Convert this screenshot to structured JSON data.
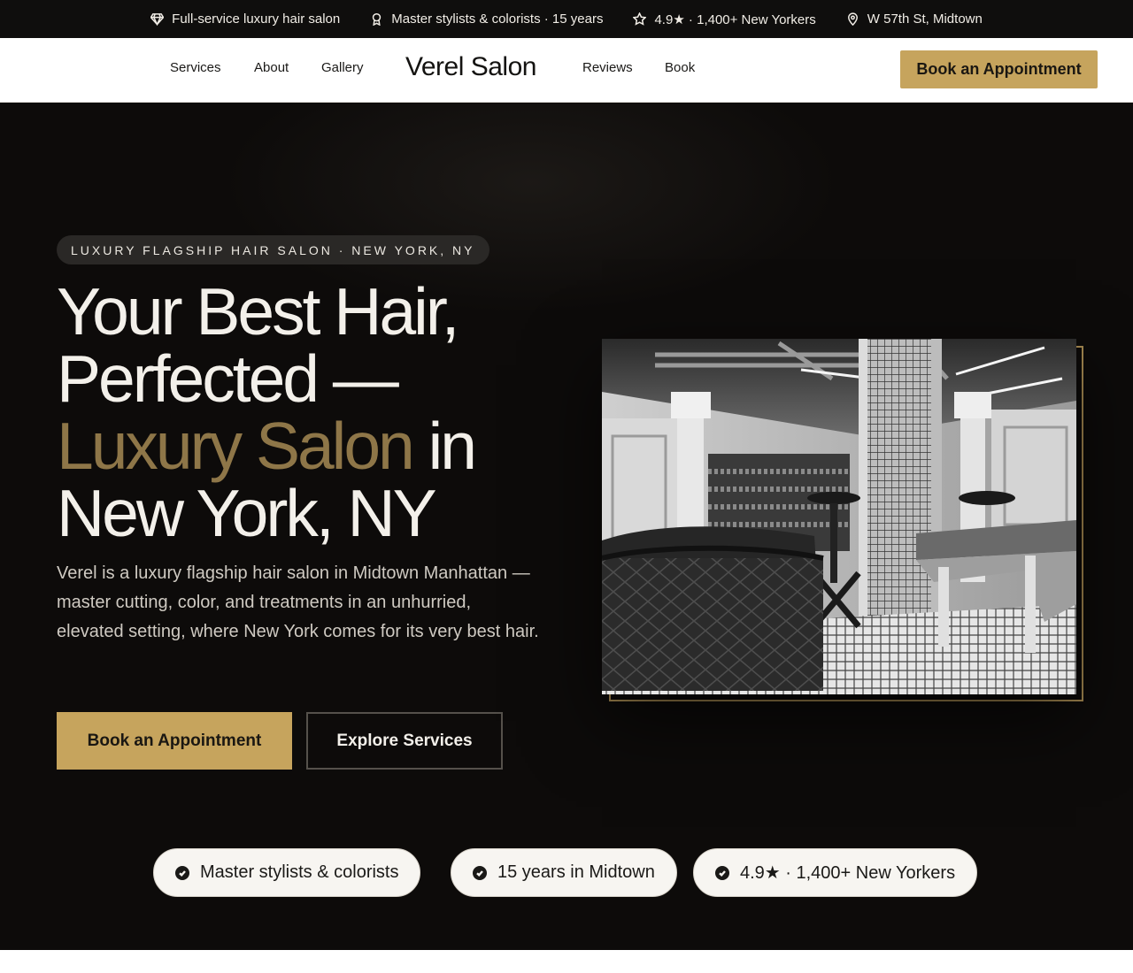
{
  "topbar": {
    "items": [
      {
        "icon": "diamond-icon",
        "text": "Full-service luxury hair salon"
      },
      {
        "icon": "award-icon",
        "text": "Master stylists & colorists · 15 years"
      },
      {
        "icon": "star-icon",
        "text": "4.9★ · 1,400+ New Yorkers"
      },
      {
        "icon": "location-pin-icon",
        "text": "W 57th St, Midtown"
      }
    ]
  },
  "nav": {
    "links_left": [
      "Services",
      "About",
      "Gallery"
    ],
    "logo": "Verel Salon",
    "links_right": [
      "Reviews",
      "Book"
    ],
    "cta": "Book an Appointment"
  },
  "hero": {
    "eyebrow": "LUXURY FLAGSHIP HAIR SALON · NEW YORK, NY",
    "headline_line1": "Your Best Hair,",
    "headline_line2": "Perfected —",
    "headline_gold": "Luxury Salon",
    "headline_after_gold": " in",
    "headline_line4": "New York, NY",
    "lead": "Verel is a luxury flagship hair salon in Midtown Manhattan — master cutting, color, and treatments in an unhurried, elevated setting, where New York comes for its very best hair.",
    "primary_cta": "Book an Appointment",
    "secondary_cta": "Explore Services"
  },
  "badges": [
    {
      "icon": "check-circle-icon",
      "text": "Master stylists & colorists"
    },
    {
      "icon": "check-circle-icon",
      "text": "15 years in Midtown"
    },
    {
      "icon": "check-circle-icon",
      "text": "4.9★ · 1,400+ New Yorkers"
    }
  ],
  "colors": {
    "accent_gold": "#c6a45d",
    "headline_gold": "#8e7648",
    "hero_background": "#0d0b0a",
    "topbar_background": "#0f0e0d"
  }
}
